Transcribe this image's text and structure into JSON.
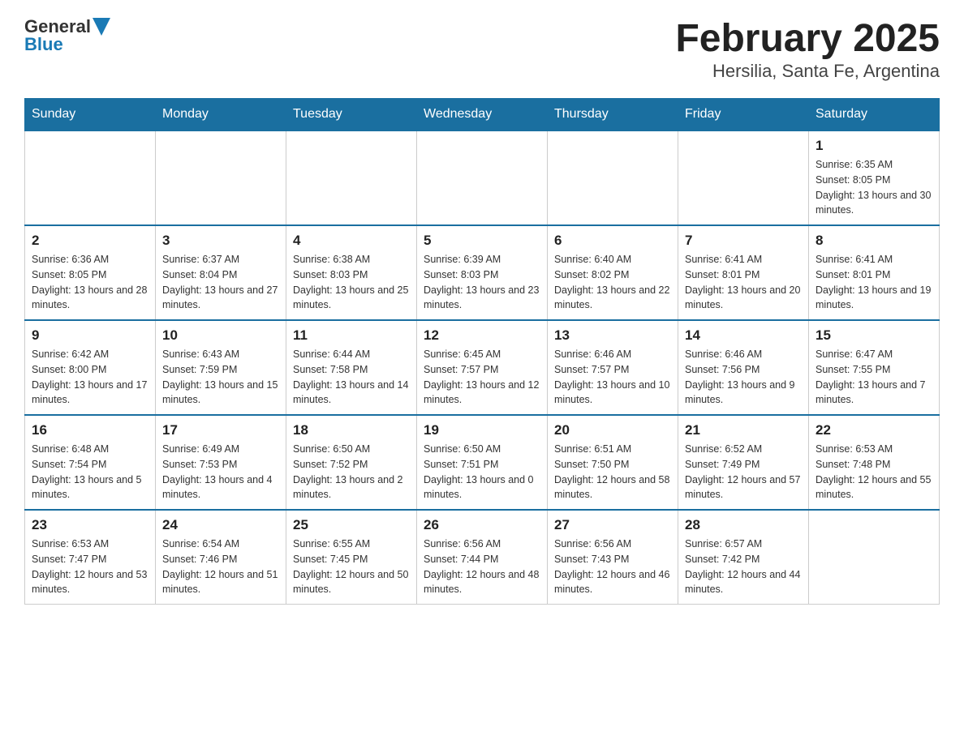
{
  "header": {
    "logo_general": "General",
    "logo_blue": "Blue",
    "month_title": "February 2025",
    "location": "Hersilia, Santa Fe, Argentina"
  },
  "weekdays": [
    "Sunday",
    "Monday",
    "Tuesday",
    "Wednesday",
    "Thursday",
    "Friday",
    "Saturday"
  ],
  "weeks": [
    [
      {
        "day": "",
        "info": ""
      },
      {
        "day": "",
        "info": ""
      },
      {
        "day": "",
        "info": ""
      },
      {
        "day": "",
        "info": ""
      },
      {
        "day": "",
        "info": ""
      },
      {
        "day": "",
        "info": ""
      },
      {
        "day": "1",
        "info": "Sunrise: 6:35 AM\nSunset: 8:05 PM\nDaylight: 13 hours and 30 minutes."
      }
    ],
    [
      {
        "day": "2",
        "info": "Sunrise: 6:36 AM\nSunset: 8:05 PM\nDaylight: 13 hours and 28 minutes."
      },
      {
        "day": "3",
        "info": "Sunrise: 6:37 AM\nSunset: 8:04 PM\nDaylight: 13 hours and 27 minutes."
      },
      {
        "day": "4",
        "info": "Sunrise: 6:38 AM\nSunset: 8:03 PM\nDaylight: 13 hours and 25 minutes."
      },
      {
        "day": "5",
        "info": "Sunrise: 6:39 AM\nSunset: 8:03 PM\nDaylight: 13 hours and 23 minutes."
      },
      {
        "day": "6",
        "info": "Sunrise: 6:40 AM\nSunset: 8:02 PM\nDaylight: 13 hours and 22 minutes."
      },
      {
        "day": "7",
        "info": "Sunrise: 6:41 AM\nSunset: 8:01 PM\nDaylight: 13 hours and 20 minutes."
      },
      {
        "day": "8",
        "info": "Sunrise: 6:41 AM\nSunset: 8:01 PM\nDaylight: 13 hours and 19 minutes."
      }
    ],
    [
      {
        "day": "9",
        "info": "Sunrise: 6:42 AM\nSunset: 8:00 PM\nDaylight: 13 hours and 17 minutes."
      },
      {
        "day": "10",
        "info": "Sunrise: 6:43 AM\nSunset: 7:59 PM\nDaylight: 13 hours and 15 minutes."
      },
      {
        "day": "11",
        "info": "Sunrise: 6:44 AM\nSunset: 7:58 PM\nDaylight: 13 hours and 14 minutes."
      },
      {
        "day": "12",
        "info": "Sunrise: 6:45 AM\nSunset: 7:57 PM\nDaylight: 13 hours and 12 minutes."
      },
      {
        "day": "13",
        "info": "Sunrise: 6:46 AM\nSunset: 7:57 PM\nDaylight: 13 hours and 10 minutes."
      },
      {
        "day": "14",
        "info": "Sunrise: 6:46 AM\nSunset: 7:56 PM\nDaylight: 13 hours and 9 minutes."
      },
      {
        "day": "15",
        "info": "Sunrise: 6:47 AM\nSunset: 7:55 PM\nDaylight: 13 hours and 7 minutes."
      }
    ],
    [
      {
        "day": "16",
        "info": "Sunrise: 6:48 AM\nSunset: 7:54 PM\nDaylight: 13 hours and 5 minutes."
      },
      {
        "day": "17",
        "info": "Sunrise: 6:49 AM\nSunset: 7:53 PM\nDaylight: 13 hours and 4 minutes."
      },
      {
        "day": "18",
        "info": "Sunrise: 6:50 AM\nSunset: 7:52 PM\nDaylight: 13 hours and 2 minutes."
      },
      {
        "day": "19",
        "info": "Sunrise: 6:50 AM\nSunset: 7:51 PM\nDaylight: 13 hours and 0 minutes."
      },
      {
        "day": "20",
        "info": "Sunrise: 6:51 AM\nSunset: 7:50 PM\nDaylight: 12 hours and 58 minutes."
      },
      {
        "day": "21",
        "info": "Sunrise: 6:52 AM\nSunset: 7:49 PM\nDaylight: 12 hours and 57 minutes."
      },
      {
        "day": "22",
        "info": "Sunrise: 6:53 AM\nSunset: 7:48 PM\nDaylight: 12 hours and 55 minutes."
      }
    ],
    [
      {
        "day": "23",
        "info": "Sunrise: 6:53 AM\nSunset: 7:47 PM\nDaylight: 12 hours and 53 minutes."
      },
      {
        "day": "24",
        "info": "Sunrise: 6:54 AM\nSunset: 7:46 PM\nDaylight: 12 hours and 51 minutes."
      },
      {
        "day": "25",
        "info": "Sunrise: 6:55 AM\nSunset: 7:45 PM\nDaylight: 12 hours and 50 minutes."
      },
      {
        "day": "26",
        "info": "Sunrise: 6:56 AM\nSunset: 7:44 PM\nDaylight: 12 hours and 48 minutes."
      },
      {
        "day": "27",
        "info": "Sunrise: 6:56 AM\nSunset: 7:43 PM\nDaylight: 12 hours and 46 minutes."
      },
      {
        "day": "28",
        "info": "Sunrise: 6:57 AM\nSunset: 7:42 PM\nDaylight: 12 hours and 44 minutes."
      },
      {
        "day": "",
        "info": ""
      }
    ]
  ]
}
